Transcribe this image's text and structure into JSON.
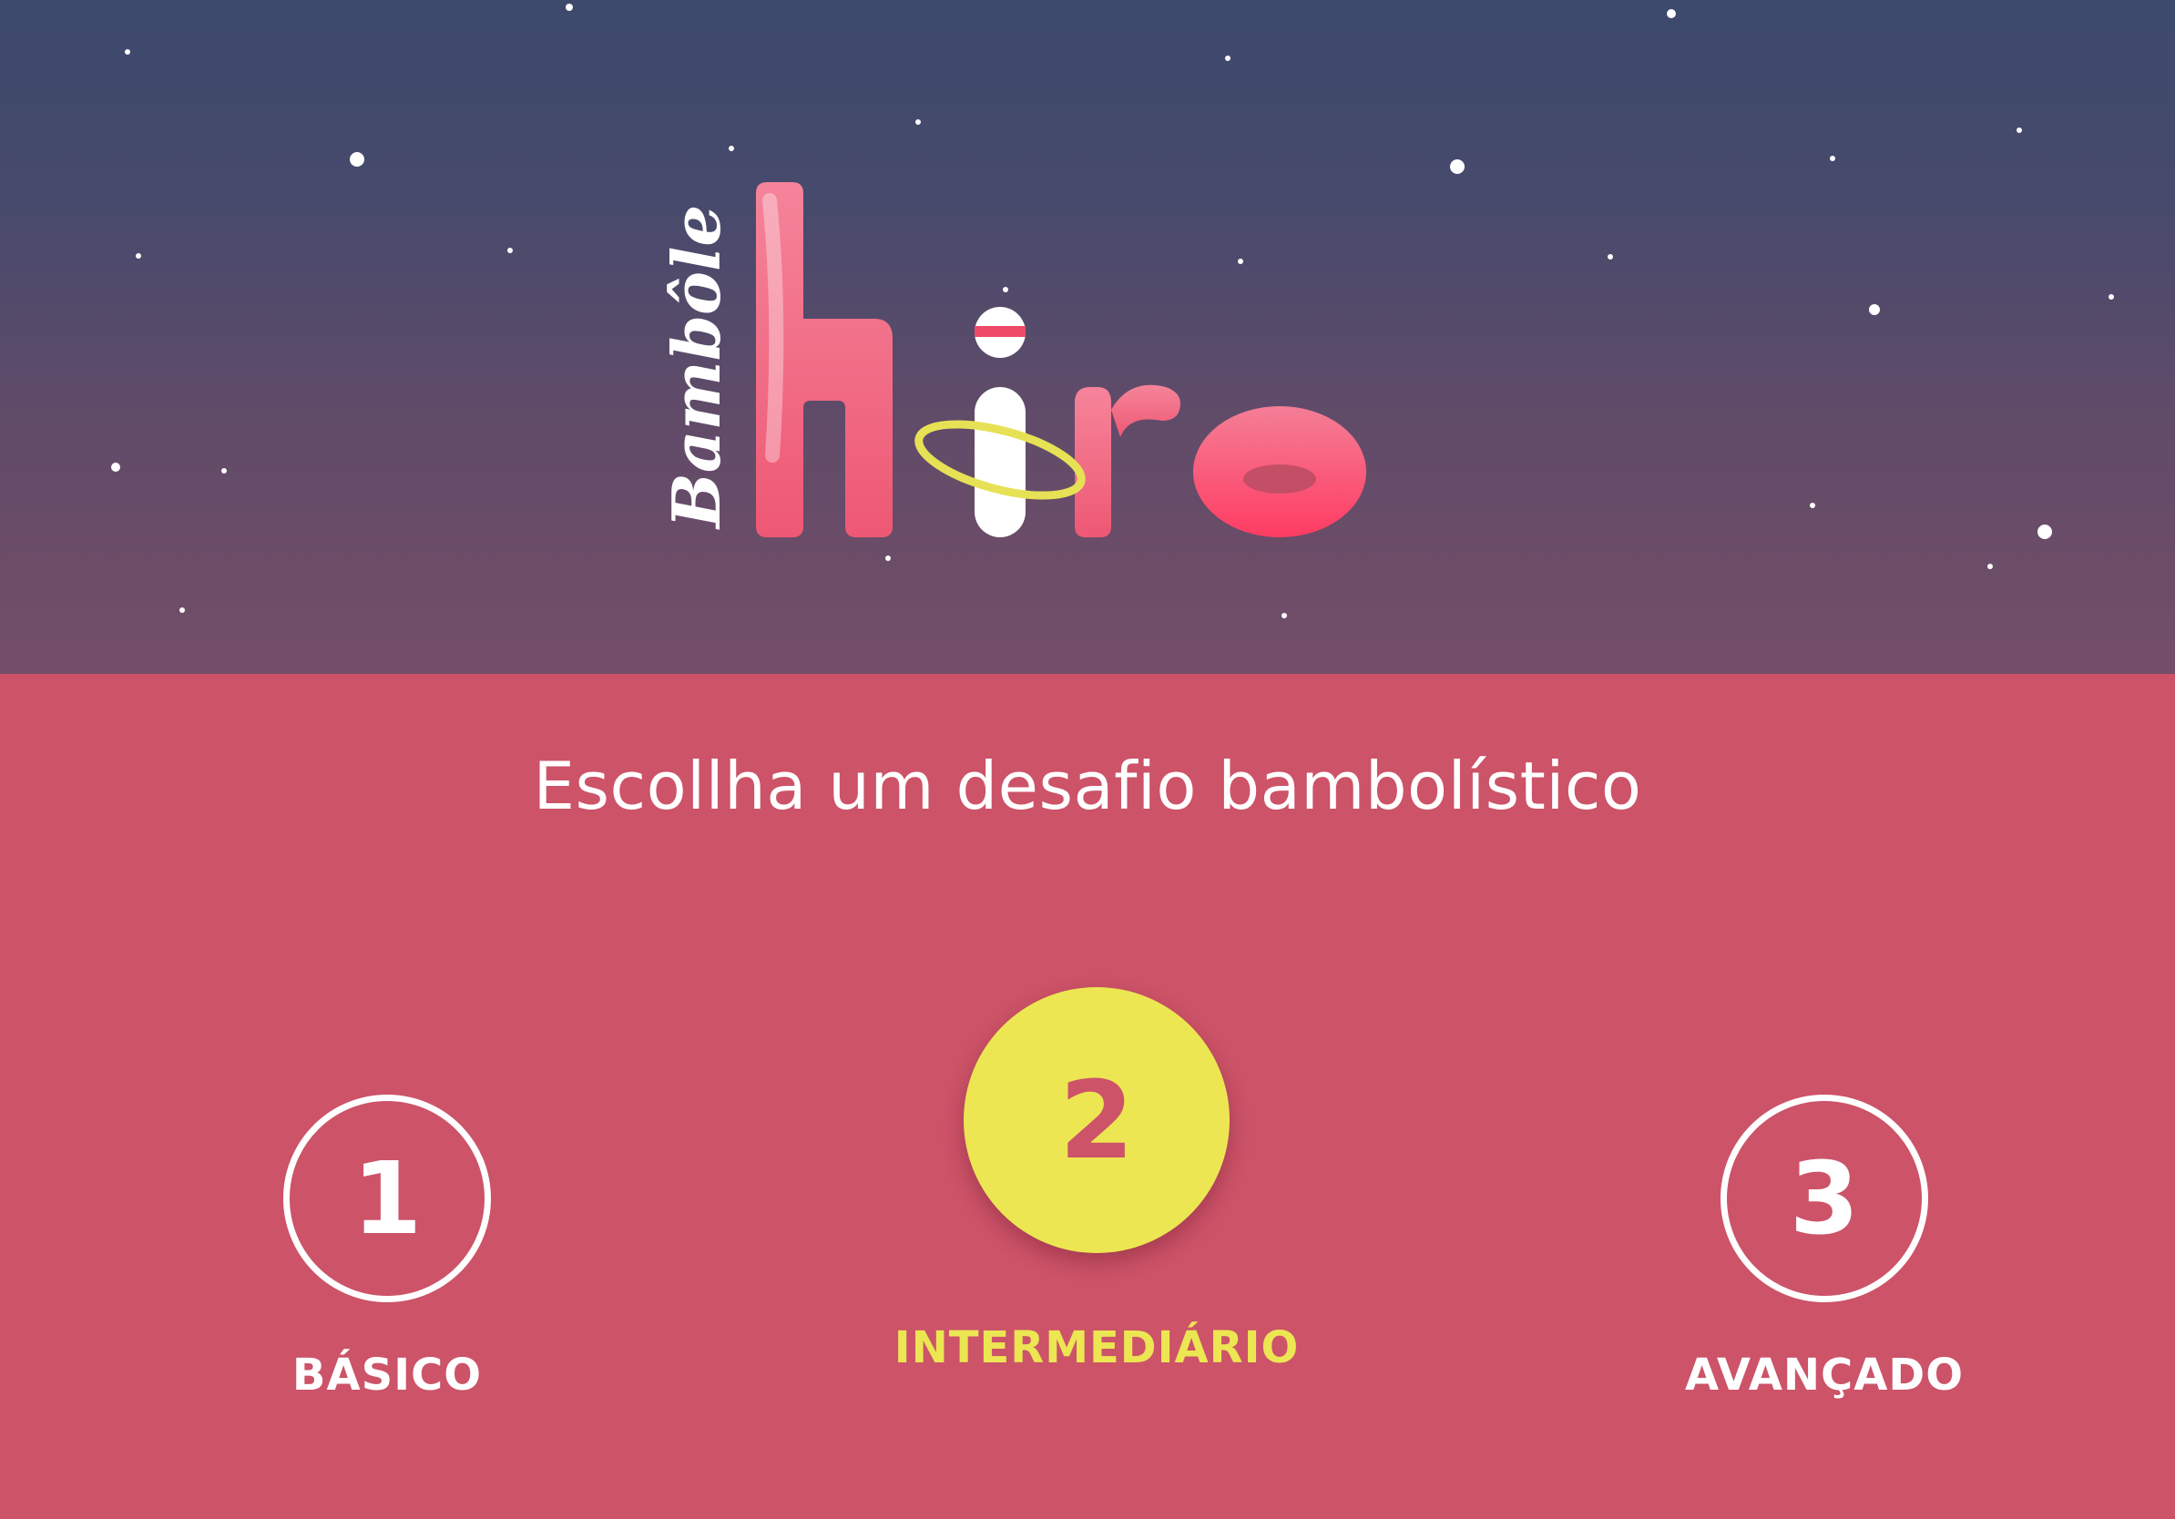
{
  "brand": {
    "prefix": "Bambôle",
    "name": "hiro"
  },
  "prompt": "Escollha um desafio bambolístico",
  "levels": [
    {
      "number": "1",
      "label": "BÁSICO",
      "selected": false
    },
    {
      "number": "2",
      "label": "INTERMEDIÁRIO",
      "selected": true
    },
    {
      "number": "3",
      "label": "AVANÇADO",
      "selected": false
    }
  ],
  "colors": {
    "sky_top": "#3d4a6c",
    "sky_bottom": "#744e68",
    "background": "#cc5368",
    "accent_yellow": "#ece652",
    "logo_pink": "#f0607a",
    "text": "#ffffff"
  }
}
